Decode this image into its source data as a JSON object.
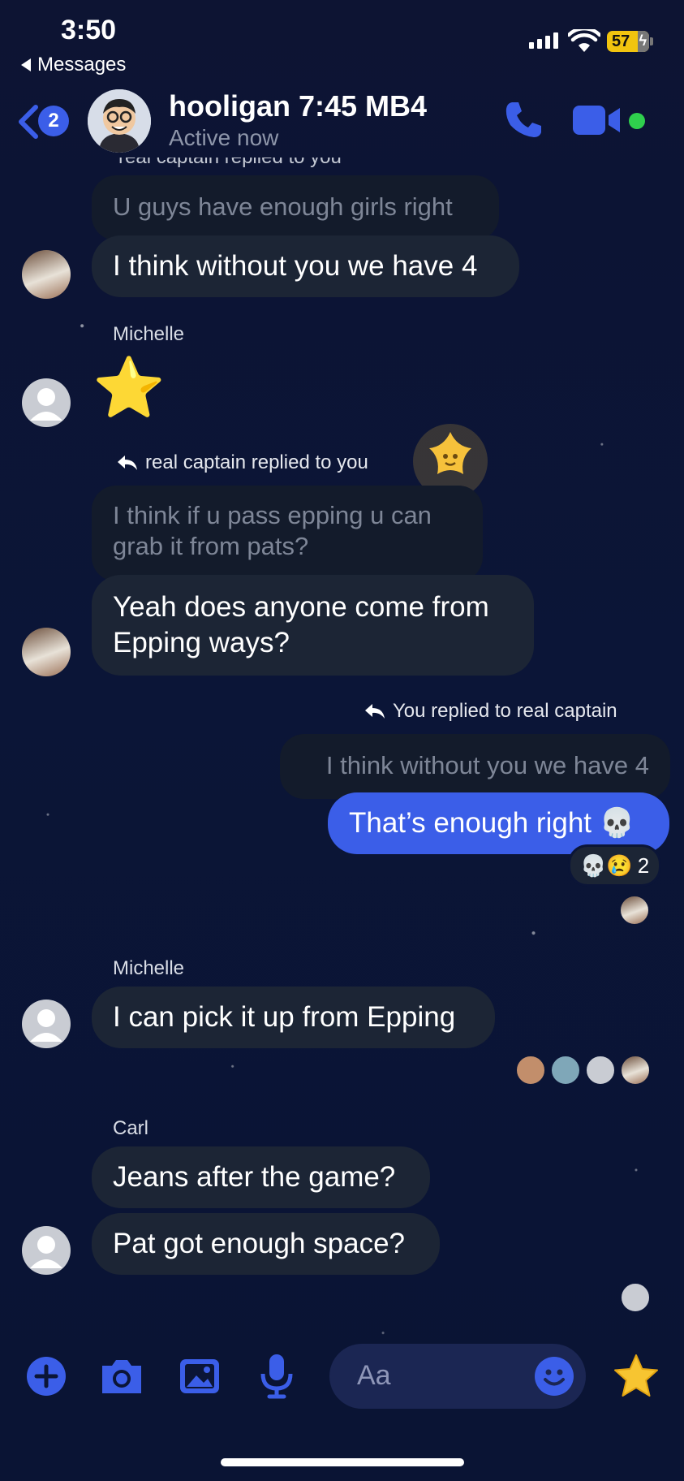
{
  "status": {
    "time": "3:50",
    "back_app": "Messages",
    "battery": "57"
  },
  "header": {
    "unread_count": "2",
    "title": "hooligan 7:45 MB4",
    "subtitle": "Active now"
  },
  "messages": {
    "top_reply_note": "real captain replied to you",
    "quoted_1": "U guys have enough girls right",
    "msg_1": "I think without you we have 4",
    "sender_michelle_1": "Michelle",
    "msg_star": "⭐",
    "reply_note_2": "real captain replied to you",
    "quoted_2_line1": "I think if u pass epping u can",
    "quoted_2_line2": "grab it from pats?",
    "msg_2_line1": "Yeah does anyone come from",
    "msg_2_line2": "Epping ways?",
    "my_reply_note": "You replied to real captain",
    "my_quoted": "I think without you we have 4",
    "my_msg": "That’s enough right 💀",
    "reaction_emojis": "💀😢",
    "reaction_count": "2",
    "sender_michelle_2": "Michelle",
    "msg_3": "I can pick it up from Epping",
    "sender_carl": "Carl",
    "msg_4": "Jeans after the game?",
    "msg_5": "Pat got enough space?"
  },
  "composer": {
    "placeholder": "Aa"
  },
  "colors": {
    "accent": "#3b5ee8",
    "bubble": "#1c2535",
    "online": "#2fcf4d"
  },
  "icons": [
    "back-chevron-icon",
    "phone-icon",
    "video-icon",
    "plus-icon",
    "camera-icon",
    "image-icon",
    "mic-icon",
    "emoji-icon",
    "star-icon",
    "reply-arrow-icon"
  ]
}
